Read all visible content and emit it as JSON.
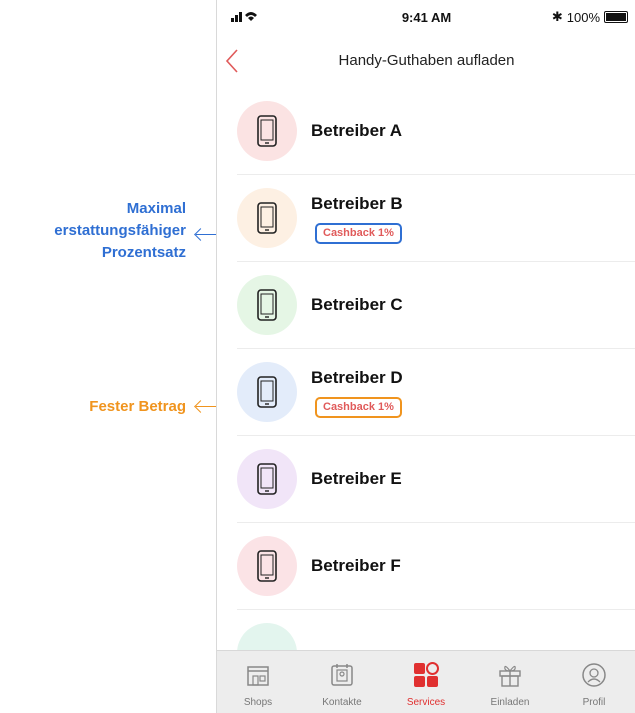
{
  "annotations": {
    "blue_line1": "Maximal",
    "blue_line2": "erstattungsfähiger",
    "blue_line3": "Prozentsatz",
    "orange": "Fester Betrag",
    "blue_color": "#2f6fd3",
    "orange_color": "#f0941e"
  },
  "statusbar": {
    "signal": "▐▐▐",
    "time": "9:41 AM",
    "bluetooth": "✱",
    "battery": "100%"
  },
  "nav": {
    "title": "Handy-Guthaben aufladen",
    "back_icon": "chevron-left-icon"
  },
  "operators": [
    {
      "name": "Betreiber A",
      "circle_color": "#fbe3e3",
      "badge": ""
    },
    {
      "name": "Betreiber B",
      "circle_color": "#fdf0e3",
      "badge": "Cashback 1%",
      "badge_style": "blue"
    },
    {
      "name": "Betreiber C",
      "circle_color": "#e5f6e5",
      "badge": ""
    },
    {
      "name": "Betreiber D",
      "circle_color": "#e3ecfa",
      "badge": "Cashback 1%",
      "badge_style": "orange"
    },
    {
      "name": "Betreiber E",
      "circle_color": "#f1e5f8",
      "badge": ""
    },
    {
      "name": "Betreiber F",
      "circle_color": "#fbe3e6",
      "badge": ""
    }
  ],
  "tabs": [
    {
      "label": "Shops",
      "icon": "shop-icon"
    },
    {
      "label": "Kontakte",
      "icon": "contacts-icon"
    },
    {
      "label": "Services",
      "icon": "services-icon",
      "active": true
    },
    {
      "label": "Einladen",
      "icon": "gift-icon"
    },
    {
      "label": "Profil",
      "icon": "profile-icon"
    }
  ],
  "accent_color": "#e03030"
}
